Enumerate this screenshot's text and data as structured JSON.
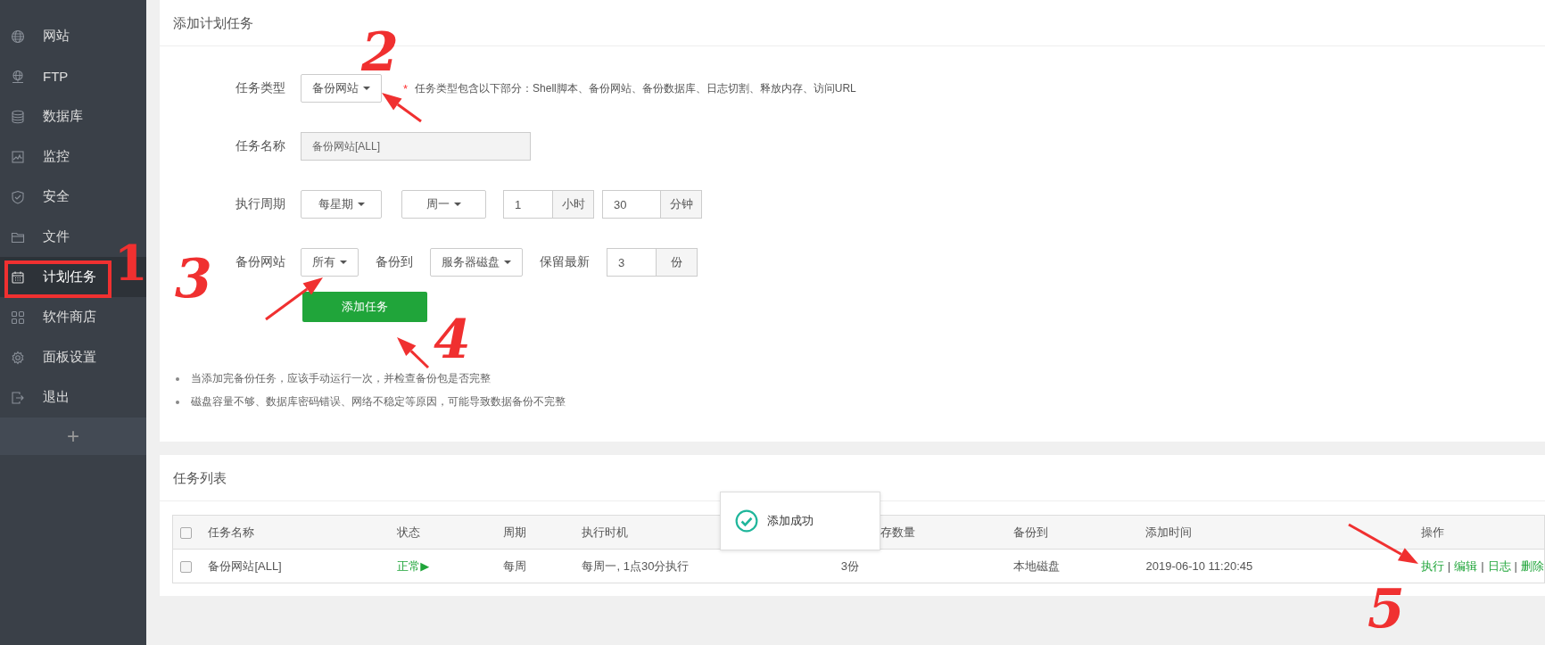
{
  "sidebar": {
    "items": [
      {
        "label": "网站",
        "kind": "globe",
        "selected": false
      },
      {
        "label": "FTP",
        "kind": "ftp",
        "selected": false
      },
      {
        "label": "数据库",
        "kind": "database",
        "selected": false
      },
      {
        "label": "监控",
        "kind": "monitor",
        "selected": false
      },
      {
        "label": "安全",
        "kind": "shield",
        "selected": false
      },
      {
        "label": "文件",
        "kind": "folder",
        "selected": false
      },
      {
        "label": "计划任务",
        "kind": "calendar",
        "selected": true
      },
      {
        "label": "软件商店",
        "kind": "grid",
        "selected": false
      },
      {
        "label": "面板设置",
        "kind": "gear",
        "selected": false
      },
      {
        "label": "退出",
        "kind": "logout",
        "selected": false
      }
    ],
    "add_label": "+"
  },
  "add_task": {
    "title": "添加计划任务",
    "task_type": {
      "label": "任务类型",
      "value": "备份网站",
      "required_mark": "*",
      "hint": "任务类型包含以下部分：Shell脚本、备份网站、备份数据库、日志切割、释放内存、访问URL"
    },
    "task_name": {
      "label": "任务名称",
      "value": "备份网站[ALL]"
    },
    "cycle": {
      "label": "执行周期",
      "period": "每星期",
      "weekday": "周一",
      "hour": "1",
      "hour_unit": "小时",
      "minute": "30",
      "minute_unit": "分钟"
    },
    "backup": {
      "label": "备份网站",
      "site": "所有",
      "to_label": "备份到",
      "target": "服务器磁盘",
      "keep_label": "保留最新",
      "keep": "3",
      "keep_unit": "份"
    },
    "submit": "添加任务",
    "notes": [
      "当添加完备份任务，应该手动运行一次，并检查备份包是否完整",
      "磁盘容量不够、数据库密码错误、网络不稳定等原因，可能导致数据备份不完整"
    ]
  },
  "task_list": {
    "title": "任务列表",
    "select_all_checked": false,
    "columns": [
      "任务名称",
      "状态",
      "周期",
      "执行时机",
      "存数量",
      "备份到",
      "添加时间",
      "操作"
    ],
    "rows": [
      {
        "checked": false,
        "name": "备份网站[ALL]",
        "status": "正常▶",
        "cycle": "每周",
        "time": "每周一, 1点30分执行",
        "count": "3份",
        "backup_to": "本地磁盘",
        "added": "2019-06-10 11:20:45",
        "actions": [
          {
            "kind": "link",
            "text": "执行"
          },
          {
            "kind": "separator",
            "text": "|"
          },
          {
            "kind": "link",
            "text": "编辑"
          },
          {
            "kind": "separator",
            "text": "|"
          },
          {
            "kind": "link",
            "text": "日志"
          },
          {
            "kind": "separator",
            "text": "|"
          },
          {
            "kind": "link",
            "text": "删除"
          }
        ]
      }
    ]
  },
  "toast": {
    "message": "添加成功"
  },
  "annotations": {
    "numbers": [
      "1",
      "2",
      "3",
      "4",
      "5"
    ]
  }
}
